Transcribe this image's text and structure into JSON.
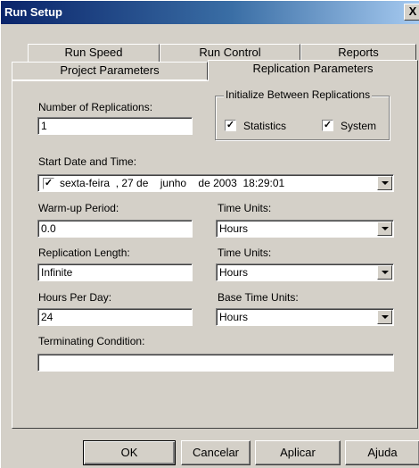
{
  "window": {
    "title": "Run Setup",
    "close_glyph": "X"
  },
  "tabs": {
    "back_row": [
      "Run Speed",
      "Run Control",
      "Reports"
    ],
    "front_row": [
      "Project Parameters",
      "Replication Parameters"
    ],
    "active": "Replication Parameters"
  },
  "form": {
    "num_replications_label": "Number of Replications:",
    "num_replications_value": "1",
    "init_group_title": "Initialize Between Replications",
    "statistics_label": "Statistics",
    "statistics_checked": "✓",
    "system_label": "System",
    "system_checked": "✓",
    "start_date_label": "Start Date and Time:",
    "start_date_checked": "✓",
    "start_date_value": "sexta-feira  , 27 de    junho    de 2003  18:29:01",
    "warmup_label": "Warm-up Period:",
    "warmup_value": "0.0",
    "warmup_units_label": "Time Units:",
    "warmup_units_value": "Hours",
    "rep_length_label": "Replication Length:",
    "rep_length_value": "Infinite",
    "rep_length_units_label": "Time Units:",
    "rep_length_units_value": "Hours",
    "hours_per_day_label": "Hours Per Day:",
    "hours_per_day_value": "24",
    "base_units_label": "Base Time Units:",
    "base_units_value": "Hours",
    "terminating_label": "Terminating Condition:",
    "terminating_value": ""
  },
  "buttons": {
    "ok": "OK",
    "cancel": "Cancelar",
    "apply": "Aplicar",
    "help": "Ajuda"
  },
  "colors": {
    "titlebar_start": "#0a246a",
    "titlebar_end": "#a6caf0",
    "face": "#d4d0c8"
  }
}
